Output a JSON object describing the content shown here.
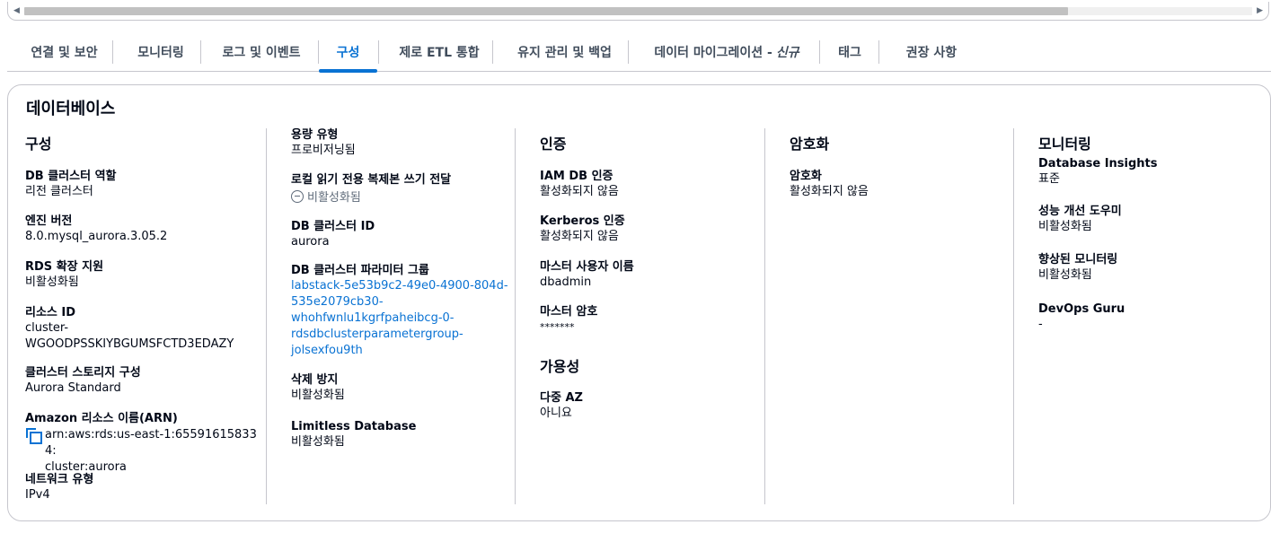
{
  "scrollbar": {
    "left_arrow": "◀",
    "right_arrow": "▶"
  },
  "tabs": [
    {
      "label": "연결 및 보안"
    },
    {
      "label": "모니터링"
    },
    {
      "label": "로그 및 이벤트"
    },
    {
      "label": "구성",
      "active": true
    },
    {
      "label": "제로 ETL 통합"
    },
    {
      "label": "유지 관리 및 백업"
    },
    {
      "label": "데이터 마이그레이션 -",
      "badge": "신규"
    },
    {
      "label": "태그"
    },
    {
      "label": "권장 사항"
    }
  ],
  "panel": {
    "title": "데이터베이스",
    "col1": {
      "heading": "구성",
      "items": [
        {
          "key": "DB 클러스터 역할",
          "value": "리전 클러스터"
        },
        {
          "key": "엔진 버전",
          "value": "8.0.mysql_aurora.3.05.2"
        },
        {
          "key": "RDS 확장 지원",
          "value": "비활성화됨"
        },
        {
          "key": "리소스 ID",
          "value": "cluster-\nWGOODPSSKIYBGUMSFCTD3EDAZY"
        },
        {
          "key": "클러스터 스토리지 구성",
          "value": "Aurora Standard"
        },
        {
          "key": "Amazon 리소스 이름(ARN)",
          "value": "arn:aws:rds:us-east-1:655916158334:\ncluster:aurora"
        },
        {
          "key": "네트워크 유형",
          "value": "IPv4"
        }
      ]
    },
    "col2": {
      "items": [
        {
          "key": "용량 유형",
          "value": "프로비저닝됨"
        },
        {
          "key": "로컬 읽기 전용 복제본 쓰기 전달",
          "value": "비활성화됨"
        },
        {
          "key": "DB 클러스터 ID",
          "value": "aurora"
        },
        {
          "key": "DB 클러스터 파라미터 그룹",
          "value": "labstack-5e53b9c2-49e0-4900-804d-\n535e2079cb30-\nwhohfwnlu1kgrfpaheibcg-0-\nrdsdbclusterparametergroup-\njolsexfou9th"
        },
        {
          "key": "삭제 방지",
          "value": "비활성화됨"
        },
        {
          "key": "Limitless Database",
          "value": "비활성화됨"
        }
      ]
    },
    "col3": {
      "heading": "인증",
      "items": [
        {
          "key": "IAM DB 인증",
          "value": "활성화되지 않음"
        },
        {
          "key": "Kerberos 인증",
          "value": "활성화되지 않음"
        },
        {
          "key": "마스터 사용자 이름",
          "value": "dbadmin"
        },
        {
          "key": "마스터 암호",
          "value": "*******"
        }
      ],
      "heading2": "가용성",
      "items2": [
        {
          "key": "다중 AZ",
          "value": "아니요"
        }
      ]
    },
    "col4": {
      "heading": "암호화",
      "items": [
        {
          "key": "암호화",
          "value": "활성화되지 않음"
        }
      ]
    },
    "col5": {
      "heading": "모니터링",
      "items": [
        {
          "key": "Database Insights",
          "value": "표준"
        },
        {
          "key": "성능 개선 도우미",
          "value": "비활성화됨"
        },
        {
          "key": "향상된 모니터링",
          "value": "비활성화됨"
        },
        {
          "key": "DevOps Guru",
          "value": "-"
        }
      ]
    }
  },
  "colors": {
    "accent": "#0972d3",
    "border": "#c6c6cd",
    "text": "#000716"
  }
}
